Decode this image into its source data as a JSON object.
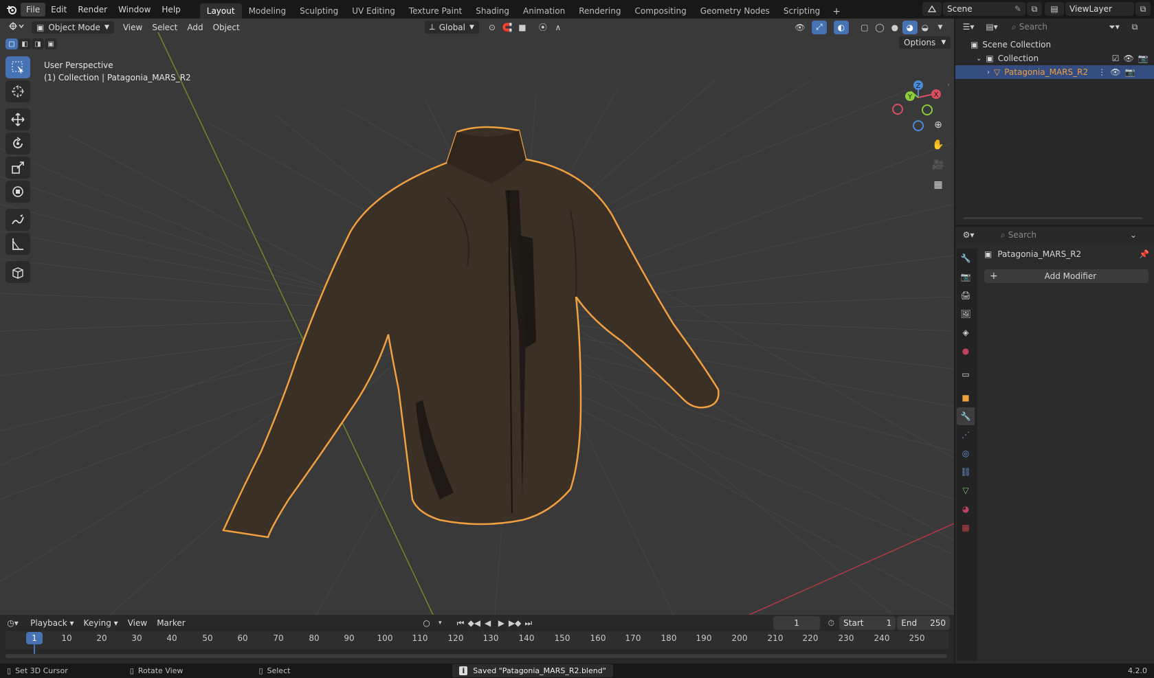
{
  "menubar": {
    "items": [
      "File",
      "Edit",
      "Render",
      "Window",
      "Help"
    ]
  },
  "workspaces": {
    "tabs": [
      "Layout",
      "Modeling",
      "Sculpting",
      "UV Editing",
      "Texture Paint",
      "Shading",
      "Animation",
      "Rendering",
      "Compositing",
      "Geometry Nodes",
      "Scripting"
    ],
    "active": "Layout",
    "add_label": "+"
  },
  "scene": {
    "name": "Scene"
  },
  "viewlayer": {
    "name": "ViewLayer"
  },
  "viewport": {
    "mode": "Object Mode",
    "menus": [
      "View",
      "Select",
      "Add",
      "Object"
    ],
    "orientation": "Global",
    "options_label": "Options",
    "overlay_title": "User Perspective",
    "overlay_subtitle": "(1) Collection | Patagonia_MARS_R2",
    "gizmo": {
      "x": "X",
      "y": "Y",
      "z": "Z"
    }
  },
  "outliner": {
    "search_placeholder": "Search",
    "scene_collection": "Scene Collection",
    "collection": "Collection",
    "object": "Patagonia_MARS_R2"
  },
  "properties": {
    "search_placeholder": "Search",
    "object_name": "Patagonia_MARS_R2",
    "add_modifier_label": "Add Modifier",
    "add_icon": "+"
  },
  "timeline": {
    "menus": [
      "Playback",
      "Keying",
      "View",
      "Marker"
    ],
    "current_frame": "1",
    "start_label": "Start",
    "start_value": "1",
    "end_label": "End",
    "end_value": "250",
    "playhead_label": "1",
    "ticks": [
      "10",
      "20",
      "30",
      "40",
      "50",
      "60",
      "70",
      "80",
      "90",
      "100",
      "110",
      "120",
      "130",
      "140",
      "150",
      "160",
      "170",
      "180",
      "190",
      "200",
      "210",
      "220",
      "230",
      "240",
      "250"
    ]
  },
  "statusbar": {
    "hint1": "Set 3D Cursor",
    "hint2": "Rotate View",
    "hint3": "Select",
    "message": "Saved \"Patagonia_MARS_R2.blend\"",
    "version": "4.2.0"
  },
  "colors": {
    "accent": "#4772b3",
    "selection_outline": "#f0a040",
    "x_axis": "#d8505f",
    "y_axis": "#8ccd3c",
    "z_axis": "#4a8ad8"
  }
}
